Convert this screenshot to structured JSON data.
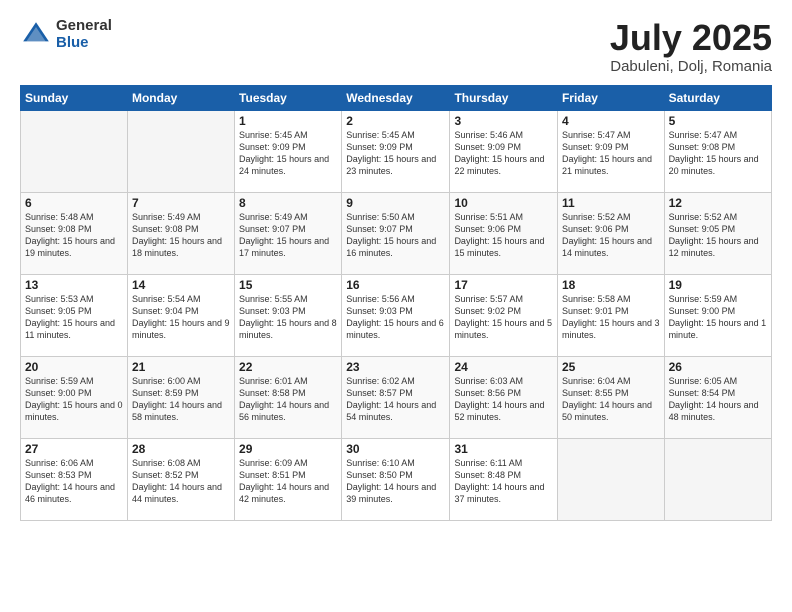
{
  "logo": {
    "general": "General",
    "blue": "Blue"
  },
  "title": {
    "month": "July 2025",
    "location": "Dabuleni, Dolj, Romania"
  },
  "weekdays": [
    "Sunday",
    "Monday",
    "Tuesday",
    "Wednesday",
    "Thursday",
    "Friday",
    "Saturday"
  ],
  "weeks": [
    [
      {
        "day": "",
        "empty": true
      },
      {
        "day": "",
        "empty": true
      },
      {
        "day": "1",
        "sunrise": "Sunrise: 5:45 AM",
        "sunset": "Sunset: 9:09 PM",
        "daylight": "Daylight: 15 hours and 24 minutes."
      },
      {
        "day": "2",
        "sunrise": "Sunrise: 5:45 AM",
        "sunset": "Sunset: 9:09 PM",
        "daylight": "Daylight: 15 hours and 23 minutes."
      },
      {
        "day": "3",
        "sunrise": "Sunrise: 5:46 AM",
        "sunset": "Sunset: 9:09 PM",
        "daylight": "Daylight: 15 hours and 22 minutes."
      },
      {
        "day": "4",
        "sunrise": "Sunrise: 5:47 AM",
        "sunset": "Sunset: 9:09 PM",
        "daylight": "Daylight: 15 hours and 21 minutes."
      },
      {
        "day": "5",
        "sunrise": "Sunrise: 5:47 AM",
        "sunset": "Sunset: 9:08 PM",
        "daylight": "Daylight: 15 hours and 20 minutes."
      }
    ],
    [
      {
        "day": "6",
        "sunrise": "Sunrise: 5:48 AM",
        "sunset": "Sunset: 9:08 PM",
        "daylight": "Daylight: 15 hours and 19 minutes."
      },
      {
        "day": "7",
        "sunrise": "Sunrise: 5:49 AM",
        "sunset": "Sunset: 9:08 PM",
        "daylight": "Daylight: 15 hours and 18 minutes."
      },
      {
        "day": "8",
        "sunrise": "Sunrise: 5:49 AM",
        "sunset": "Sunset: 9:07 PM",
        "daylight": "Daylight: 15 hours and 17 minutes."
      },
      {
        "day": "9",
        "sunrise": "Sunrise: 5:50 AM",
        "sunset": "Sunset: 9:07 PM",
        "daylight": "Daylight: 15 hours and 16 minutes."
      },
      {
        "day": "10",
        "sunrise": "Sunrise: 5:51 AM",
        "sunset": "Sunset: 9:06 PM",
        "daylight": "Daylight: 15 hours and 15 minutes."
      },
      {
        "day": "11",
        "sunrise": "Sunrise: 5:52 AM",
        "sunset": "Sunset: 9:06 PM",
        "daylight": "Daylight: 15 hours and 14 minutes."
      },
      {
        "day": "12",
        "sunrise": "Sunrise: 5:52 AM",
        "sunset": "Sunset: 9:05 PM",
        "daylight": "Daylight: 15 hours and 12 minutes."
      }
    ],
    [
      {
        "day": "13",
        "sunrise": "Sunrise: 5:53 AM",
        "sunset": "Sunset: 9:05 PM",
        "daylight": "Daylight: 15 hours and 11 minutes."
      },
      {
        "day": "14",
        "sunrise": "Sunrise: 5:54 AM",
        "sunset": "Sunset: 9:04 PM",
        "daylight": "Daylight: 15 hours and 9 minutes."
      },
      {
        "day": "15",
        "sunrise": "Sunrise: 5:55 AM",
        "sunset": "Sunset: 9:03 PM",
        "daylight": "Daylight: 15 hours and 8 minutes."
      },
      {
        "day": "16",
        "sunrise": "Sunrise: 5:56 AM",
        "sunset": "Sunset: 9:03 PM",
        "daylight": "Daylight: 15 hours and 6 minutes."
      },
      {
        "day": "17",
        "sunrise": "Sunrise: 5:57 AM",
        "sunset": "Sunset: 9:02 PM",
        "daylight": "Daylight: 15 hours and 5 minutes."
      },
      {
        "day": "18",
        "sunrise": "Sunrise: 5:58 AM",
        "sunset": "Sunset: 9:01 PM",
        "daylight": "Daylight: 15 hours and 3 minutes."
      },
      {
        "day": "19",
        "sunrise": "Sunrise: 5:59 AM",
        "sunset": "Sunset: 9:00 PM",
        "daylight": "Daylight: 15 hours and 1 minute."
      }
    ],
    [
      {
        "day": "20",
        "sunrise": "Sunrise: 5:59 AM",
        "sunset": "Sunset: 9:00 PM",
        "daylight": "Daylight: 15 hours and 0 minutes."
      },
      {
        "day": "21",
        "sunrise": "Sunrise: 6:00 AM",
        "sunset": "Sunset: 8:59 PM",
        "daylight": "Daylight: 14 hours and 58 minutes."
      },
      {
        "day": "22",
        "sunrise": "Sunrise: 6:01 AM",
        "sunset": "Sunset: 8:58 PM",
        "daylight": "Daylight: 14 hours and 56 minutes."
      },
      {
        "day": "23",
        "sunrise": "Sunrise: 6:02 AM",
        "sunset": "Sunset: 8:57 PM",
        "daylight": "Daylight: 14 hours and 54 minutes."
      },
      {
        "day": "24",
        "sunrise": "Sunrise: 6:03 AM",
        "sunset": "Sunset: 8:56 PM",
        "daylight": "Daylight: 14 hours and 52 minutes."
      },
      {
        "day": "25",
        "sunrise": "Sunrise: 6:04 AM",
        "sunset": "Sunset: 8:55 PM",
        "daylight": "Daylight: 14 hours and 50 minutes."
      },
      {
        "day": "26",
        "sunrise": "Sunrise: 6:05 AM",
        "sunset": "Sunset: 8:54 PM",
        "daylight": "Daylight: 14 hours and 48 minutes."
      }
    ],
    [
      {
        "day": "27",
        "sunrise": "Sunrise: 6:06 AM",
        "sunset": "Sunset: 8:53 PM",
        "daylight": "Daylight: 14 hours and 46 minutes."
      },
      {
        "day": "28",
        "sunrise": "Sunrise: 6:08 AM",
        "sunset": "Sunset: 8:52 PM",
        "daylight": "Daylight: 14 hours and 44 minutes."
      },
      {
        "day": "29",
        "sunrise": "Sunrise: 6:09 AM",
        "sunset": "Sunset: 8:51 PM",
        "daylight": "Daylight: 14 hours and 42 minutes."
      },
      {
        "day": "30",
        "sunrise": "Sunrise: 6:10 AM",
        "sunset": "Sunset: 8:50 PM",
        "daylight": "Daylight: 14 hours and 39 minutes."
      },
      {
        "day": "31",
        "sunrise": "Sunrise: 6:11 AM",
        "sunset": "Sunset: 8:48 PM",
        "daylight": "Daylight: 14 hours and 37 minutes."
      },
      {
        "day": "",
        "empty": true
      },
      {
        "day": "",
        "empty": true
      }
    ]
  ]
}
